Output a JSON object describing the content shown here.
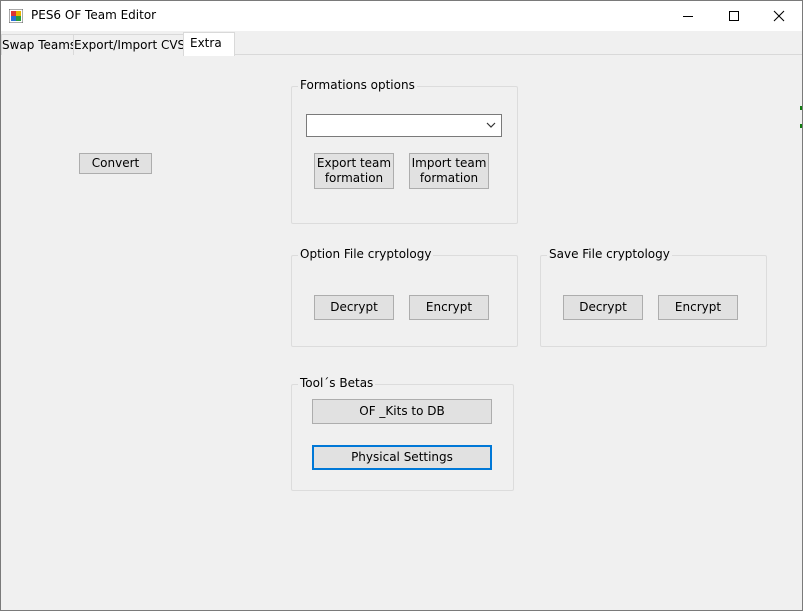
{
  "window": {
    "title": "PES6 OF Team Editor",
    "controls": {
      "minimize": "minimize",
      "maximize": "maximize",
      "close": "close"
    }
  },
  "tabs": [
    {
      "label": "Swap Teams",
      "active": false
    },
    {
      "label": "Export/Import CVS",
      "active": false
    },
    {
      "label": "Extra",
      "active": true
    }
  ],
  "extra": {
    "convert_label": "Convert",
    "formations": {
      "title": "Formations options",
      "dropdown_value": "",
      "export_label": "Export team formation",
      "import_label": "Import team formation"
    },
    "option_file": {
      "title": "Option File cryptology",
      "decrypt_label": "Decrypt",
      "encrypt_label": "Encrypt"
    },
    "save_file": {
      "title": "Save File cryptology",
      "decrypt_label": "Decrypt",
      "encrypt_label": "Encrypt"
    },
    "betas": {
      "title": "Tool´s Betas",
      "kits_label": "OF _Kits to DB",
      "physical_label": "Physical Settings"
    }
  },
  "colors": {
    "focus_border": "#0078d7",
    "button_face": "#e1e1e1",
    "button_border": "#adadad",
    "window_bg": "#f0f0f0"
  }
}
